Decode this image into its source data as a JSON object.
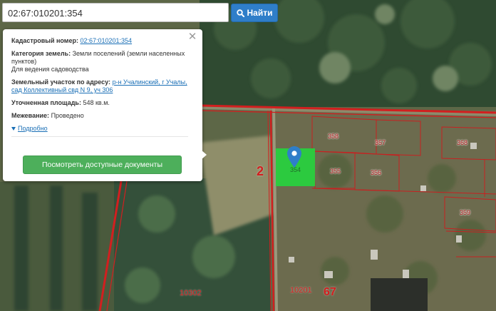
{
  "search": {
    "value": "02:67:010201:354",
    "button_label": "Найти"
  },
  "popup": {
    "cadastral_label": "Кадастровый номер:",
    "cadastral_value": "02:67:010201:354",
    "category_label": "Категория земель:",
    "category_value": "Земли поселений (земли населенных пунктов)",
    "category_use": "Для ведения садоводства",
    "address_label": "Земельный участок по адресу:",
    "address_value": "р-н Учалинский, г Учалы, сад Коллективный свд N 9, уч 306",
    "area_label": "Уточненная площадь:",
    "area_value": "548 кв.м.",
    "survey_label": "Межевание:",
    "survey_value": "Проведено",
    "details_label": "Подробно",
    "docs_button": "Посмотреть доступные документы"
  },
  "map": {
    "parcels": [
      "358",
      "357",
      "368",
      "355",
      "356",
      "359"
    ],
    "selected_parcel": "354",
    "quarter_big": "2",
    "block_left": "10302",
    "block_mid": "10201",
    "block_right": "67"
  },
  "colors": {
    "search_button": "#2f7ec9",
    "docs_button": "#4daf5b",
    "selected_parcel": "#27d23e",
    "boundary": "#d21f1f"
  }
}
